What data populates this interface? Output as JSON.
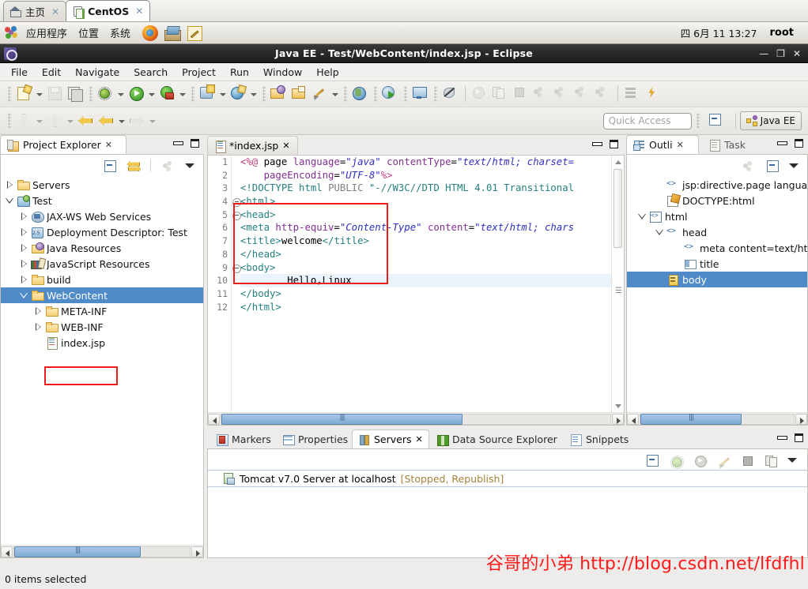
{
  "vm": {
    "tabs": [
      {
        "label": "主页",
        "icon": "home-icon",
        "active": false,
        "close": "✕"
      },
      {
        "label": "CentOS",
        "icon": "vm-icon",
        "active": true,
        "close": "✕"
      }
    ]
  },
  "gnome": {
    "menus": [
      "应用程序",
      "位置",
      "系统"
    ],
    "launchers": [
      "firefox-icon",
      "package-manager-icon",
      "text-editor-icon"
    ],
    "clock": "四 6月 11 13:27",
    "user": "root"
  },
  "eclipse": {
    "title": "Java EE - Test/WebContent/index.jsp - Eclipse",
    "window_buttons": {
      "minimize": "—",
      "maximize": "❐",
      "close": "✕"
    },
    "menu": [
      "File",
      "Edit",
      "Navigate",
      "Search",
      "Project",
      "Run",
      "Window",
      "Help"
    ],
    "toolbar_icons": [
      "new-document-icon",
      "save-icon",
      "save-all-icon",
      "debug-icon",
      "run-icon",
      "run-as-server-icon",
      "new-server-icon",
      "search-icon",
      "open-type-icon",
      "open-resource-icon",
      "annotate-icon",
      "open-web-browser-icon",
      "web-browser-icon",
      "display-selected-console-icon",
      "skip-breakpoints-icon",
      "step-into-icon",
      "step-over-icon",
      "terminate-icon",
      "resume-icon",
      "step-return-icon",
      "drop-to-frame-icon",
      "use-step-filters-icon",
      "show-whitespace-icon",
      "toggle-mark-icon"
    ],
    "toolbar2_icons": [
      "previous-annotation-icon",
      "next-annotation-icon",
      "back-icon",
      "forward-icon"
    ],
    "quick_access_placeholder": "Quick Access",
    "open_perspective_icon": "open-perspective-icon",
    "perspective": {
      "label": "Java EE",
      "icon": "java-ee-perspective-icon"
    }
  },
  "project_explorer": {
    "tab_label": "Project Explorer",
    "tab_close": "✕",
    "toolbar_icons": [
      "collapse-all-icon",
      "link-with-editor-icon",
      "focus-on-active-task-icon",
      "view-menu-icon"
    ],
    "tree": [
      {
        "label": "Servers",
        "indent": 0,
        "twisty": "collapsed",
        "icon": "folder-icon",
        "selected": false
      },
      {
        "label": "Test",
        "indent": 0,
        "twisty": "expanded",
        "icon": "project-icon",
        "selected": false
      },
      {
        "label": "JAX-WS Web Services",
        "indent": 1,
        "twisty": "collapsed",
        "icon": "jaxws-icon",
        "selected": false
      },
      {
        "label": "Deployment Descriptor: Test",
        "indent": 1,
        "twisty": "collapsed",
        "icon": "deployment-descriptor-icon",
        "selected": false
      },
      {
        "label": "Java Resources",
        "indent": 1,
        "twisty": "collapsed",
        "icon": "java-resources-icon",
        "selected": false
      },
      {
        "label": "JavaScript Resources",
        "indent": 1,
        "twisty": "collapsed",
        "icon": "javascript-resources-icon",
        "selected": false
      },
      {
        "label": "build",
        "indent": 1,
        "twisty": "collapsed",
        "icon": "folder-icon",
        "selected": false
      },
      {
        "label": "WebContent",
        "indent": 1,
        "twisty": "expanded",
        "icon": "folder-icon",
        "selected": true
      },
      {
        "label": "META-INF",
        "indent": 2,
        "twisty": "collapsed",
        "icon": "folder-icon",
        "selected": false
      },
      {
        "label": "WEB-INF",
        "indent": 2,
        "twisty": "collapsed",
        "icon": "folder-icon",
        "selected": false
      },
      {
        "label": "index.jsp",
        "indent": 2,
        "twisty": "none",
        "icon": "jsp-file-icon",
        "selected": false,
        "highlighted": true
      }
    ]
  },
  "editor": {
    "tab_label": "*index.jsp",
    "tab_close": "✕",
    "tab_icon": "jsp-file-icon",
    "minimize_icon": "minimize-icon",
    "maximize_icon": "maximize-icon",
    "lines": [
      {
        "n": "1",
        "fold": false,
        "hl": false,
        "segs": [
          {
            "t": "<%@",
            "c": "jsp"
          },
          {
            "t": " page ",
            "c": "txt"
          },
          {
            "t": "language",
            "c": "attr"
          },
          {
            "t": "=",
            "c": "txt"
          },
          {
            "t": "\"java\"",
            "c": "val"
          },
          {
            "t": " ",
            "c": "txt"
          },
          {
            "t": "contentType",
            "c": "attr"
          },
          {
            "t": "=",
            "c": "txt"
          },
          {
            "t": "\"text/html; charset=",
            "c": "val"
          }
        ]
      },
      {
        "n": "2",
        "fold": false,
        "hl": false,
        "segs": [
          {
            "t": "    ",
            "c": "txt"
          },
          {
            "t": "pageEncoding",
            "c": "attr"
          },
          {
            "t": "=",
            "c": "txt"
          },
          {
            "t": "\"UTF-8\"",
            "c": "val"
          },
          {
            "t": "%>",
            "c": "jsp"
          }
        ]
      },
      {
        "n": "3",
        "fold": false,
        "hl": false,
        "segs": [
          {
            "t": "<!DOCTYPE html ",
            "c": "tag"
          },
          {
            "t": "PUBLIC ",
            "c": "gray"
          },
          {
            "t": "\"-//W3C//DTD HTML 4.01 Transitional",
            "c": "tag"
          }
        ]
      },
      {
        "n": "4",
        "fold": true,
        "hl": false,
        "segs": [
          {
            "t": "<html>",
            "c": "tag"
          }
        ]
      },
      {
        "n": "5",
        "fold": true,
        "hl": false,
        "segs": [
          {
            "t": "<head>",
            "c": "tag"
          }
        ]
      },
      {
        "n": "6",
        "fold": false,
        "hl": false,
        "segs": [
          {
            "t": "<meta ",
            "c": "tag"
          },
          {
            "t": "http-equiv",
            "c": "attr"
          },
          {
            "t": "=",
            "c": "txt"
          },
          {
            "t": "\"Content-Type\"",
            "c": "val"
          },
          {
            "t": " ",
            "c": "txt"
          },
          {
            "t": "content",
            "c": "attr"
          },
          {
            "t": "=",
            "c": "txt"
          },
          {
            "t": "\"text/html; chars",
            "c": "val"
          }
        ]
      },
      {
        "n": "7",
        "fold": false,
        "hl": false,
        "segs": [
          {
            "t": "<title>",
            "c": "tag"
          },
          {
            "t": "welcome",
            "c": "txt"
          },
          {
            "t": "</title>",
            "c": "tag"
          }
        ]
      },
      {
        "n": "8",
        "fold": false,
        "hl": false,
        "segs": [
          {
            "t": "</head>",
            "c": "tag"
          }
        ]
      },
      {
        "n": "9",
        "fold": true,
        "hl": false,
        "segs": [
          {
            "t": "<body>",
            "c": "tag"
          }
        ]
      },
      {
        "n": "10",
        "fold": false,
        "hl": true,
        "segs": [
          {
            "t": "        Hello,Linux",
            "c": "txt"
          }
        ]
      },
      {
        "n": "11",
        "fold": false,
        "hl": false,
        "segs": [
          {
            "t": "</body>",
            "c": "tag"
          }
        ]
      },
      {
        "n": "12",
        "fold": false,
        "hl": false,
        "segs": [
          {
            "t": "</html>",
            "c": "tag"
          }
        ]
      }
    ]
  },
  "outline": {
    "tabs": [
      {
        "label": "Outli",
        "icon": "outline-icon",
        "close": "✕",
        "selected": true
      },
      {
        "label": "Task",
        "icon": "task-icon",
        "close": "",
        "selected": false
      }
    ],
    "toolbar_icons": [
      "focus-on-active-task-icon",
      "collapse-all-icon",
      "view-menu-icon"
    ],
    "tree": [
      {
        "label": "jsp:directive.page language",
        "indent": 1,
        "twisty": "none",
        "icon": "angle-brackets-icon",
        "selected": false
      },
      {
        "label": "DOCTYPE:html",
        "indent": 1,
        "twisty": "none",
        "icon": "doctype-icon",
        "selected": false
      },
      {
        "label": "html",
        "indent": 0,
        "twisty": "expanded",
        "icon": "html-element-icon",
        "selected": false
      },
      {
        "label": "head",
        "indent": 1,
        "twisty": "expanded",
        "icon": "angle-brackets-icon",
        "selected": false
      },
      {
        "label": "meta content=text/htm",
        "indent": 2,
        "twisty": "none",
        "icon": "angle-brackets-icon",
        "selected": false
      },
      {
        "label": "title",
        "indent": 2,
        "twisty": "none",
        "icon": "title-element-icon",
        "selected": false
      },
      {
        "label": "body",
        "indent": 1,
        "twisty": "none",
        "icon": "body-element-icon",
        "selected": true
      }
    ]
  },
  "bottom_panel": {
    "tabs": [
      {
        "label": "Markers",
        "icon": "markers-icon",
        "selected": false,
        "close": ""
      },
      {
        "label": "Properties",
        "icon": "properties-icon",
        "selected": false,
        "close": ""
      },
      {
        "label": "Servers",
        "icon": "servers-icon",
        "selected": true,
        "close": "✕"
      },
      {
        "label": "Data Source Explorer",
        "icon": "data-source-explorer-icon",
        "selected": false,
        "close": ""
      },
      {
        "label": "Snippets",
        "icon": "snippets-icon",
        "selected": false,
        "close": ""
      }
    ],
    "toolbar_icons": [
      "collapse-all-icon",
      "debug-server-icon",
      "start-server-icon",
      "profile-server-icon",
      "stop-server-icon",
      "publish-icon",
      "view-menu-icon"
    ],
    "rows": [
      {
        "icon": "server-icon",
        "name": "Tomcat v7.0 Server at localhost",
        "state": "[Stopped, Republish]"
      }
    ]
  },
  "status_bar": {
    "text": "0 items selected"
  },
  "watermark": {
    "text": "谷哥的小弟 http://blog.csdn.net/lfdfhl",
    "color": "#ff1a1a"
  },
  "scroll": {
    "explorer_hthumb": "|||",
    "outline_hthumb": "|||",
    "editor_hthumb": "|||"
  }
}
